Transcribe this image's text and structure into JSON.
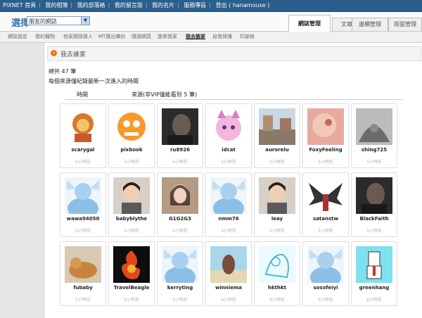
{
  "topbar": {
    "items": [
      "PIXNET 首頁",
      "我的相簿",
      "我的部落格",
      "我的留言版",
      "我的名片",
      "服務專區",
      "登出 ( hanamouse )"
    ]
  },
  "header": {
    "select_label": "選擇",
    "select_value": "朋友的網誌",
    "tabs": [
      "網誌管理",
      "文章管理",
      "邊欄管理",
      "版面管理"
    ]
  },
  "subnav": [
    "網誌設定",
    "我的寵物",
    "他家網誌匯入",
    "MT匯出備份",
    "隨選網頁",
    "誰來我家",
    "我去誰家",
    "自我保護",
    "印部格"
  ],
  "section": {
    "title": "我去誰家",
    "total": "總共 47 筆",
    "note": "每個來源僅紀錄最新一次進入的時間",
    "col_time": "時間",
    "col_source": "來源(非VIP僅能看到 5 筆)"
  },
  "visits": [
    {
      "name": "scarygal",
      "time": "5小時前",
      "thumb": "lion"
    },
    {
      "name": "pixbook",
      "time": "5小時前",
      "thumb": "cartoon"
    },
    {
      "name": "ru8926",
      "time": "5小時前",
      "thumb": "photo-dark"
    },
    {
      "name": "idcat",
      "time": "5小時前",
      "thumb": "pink-cat"
    },
    {
      "name": "aurorelu",
      "time": "5小時前",
      "thumb": "photo-street"
    },
    {
      "name": "FoxyFeeling",
      "time": "5小時前",
      "thumb": "photo-face"
    },
    {
      "name": "shing725",
      "time": "5小時前",
      "thumb": "photo-hands"
    },
    {
      "name": "wawa94050",
      "time": "5小時前",
      "thumb": "default-avatar"
    },
    {
      "name": "babyblythe",
      "time": "5小時前",
      "thumb": "photo-girl"
    },
    {
      "name": "G1G2G3",
      "time": "5小時前",
      "thumb": "photo-portrait"
    },
    {
      "name": "nmm76",
      "time": "5小時前",
      "thumb": "default-avatar"
    },
    {
      "name": "leay",
      "time": "5小時前",
      "thumb": "photo-girl"
    },
    {
      "name": "satanstw",
      "time": "5小時前",
      "thumb": "winged"
    },
    {
      "name": "BlackFaith",
      "time": "5小時前",
      "thumb": "photo-dark"
    },
    {
      "name": "fubaby",
      "time": "5小時前",
      "thumb": "photo-cat"
    },
    {
      "name": "TravelBeagle",
      "time": "5小時前",
      "thumb": "fire"
    },
    {
      "name": "kerryting",
      "time": "5小時前",
      "thumb": "default-avatar"
    },
    {
      "name": "winniema",
      "time": "6小時前",
      "thumb": "photo-beach"
    },
    {
      "name": "hkthkt",
      "time": "6小時前",
      "thumb": "sketch"
    },
    {
      "name": "sosofeiyi",
      "time": "6小時前",
      "thumb": "default-avatar"
    },
    {
      "name": "greenhang",
      "time": "6小時前",
      "thumb": "comic"
    }
  ]
}
